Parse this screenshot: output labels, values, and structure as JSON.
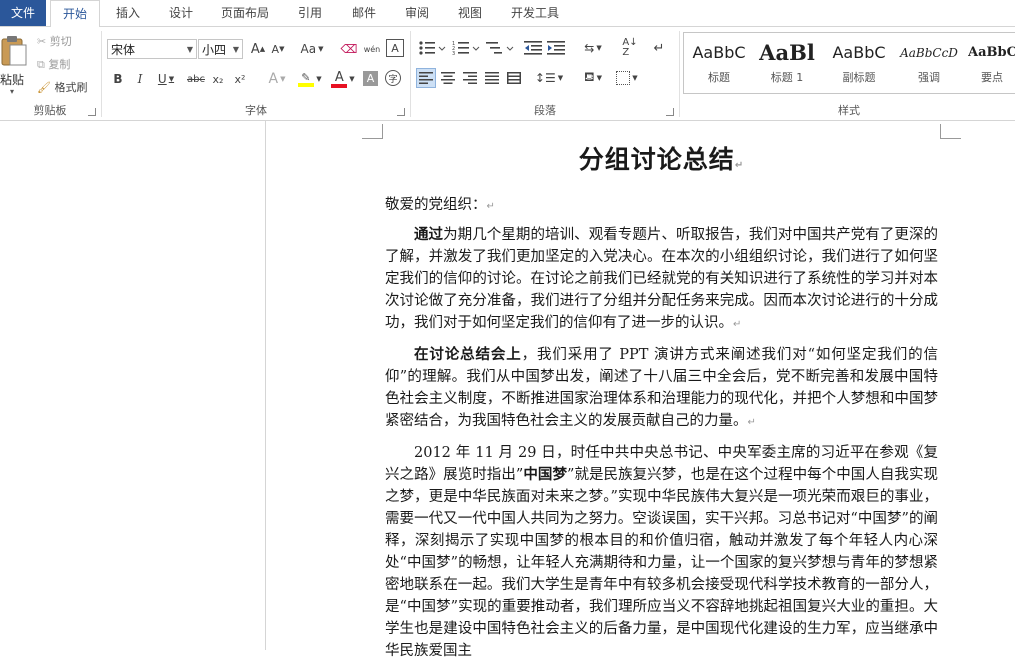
{
  "tabs": {
    "file": "文件",
    "home": "开始",
    "insert": "插入",
    "design": "设计",
    "layout": "页面布局",
    "references": "引用",
    "mailings": "邮件",
    "review": "审阅",
    "view": "视图",
    "developer": "开发工具"
  },
  "clipboard": {
    "paste": "粘贴",
    "cut": "剪切",
    "copy": "复制",
    "format_painter": "格式刷",
    "label": "剪贴板"
  },
  "font": {
    "name": "宋体",
    "size": "小四",
    "label": "字体",
    "grow": "A",
    "shrink": "A",
    "case": "Aa",
    "phonetic": "wén",
    "border_char": "A",
    "bold": "B",
    "italic": "I",
    "underline": "U",
    "strike": "abc",
    "subscript": "x₂",
    "superscript": "x²",
    "effects": "A",
    "font_color": "A",
    "shading": "A",
    "enclose": "字",
    "highlight_color": "#ffff00",
    "font_color_value": "#e81123"
  },
  "paragraph": {
    "label": "段落"
  },
  "styles": {
    "label": "样式",
    "items": [
      {
        "sample": "AaBbC",
        "name": "标题"
      },
      {
        "sample": "AaBl",
        "name": "标题 1"
      },
      {
        "sample": "AaBbC",
        "name": "副标题"
      },
      {
        "sample": "AaBbCcD",
        "name": "强调"
      },
      {
        "sample": "AaBbC",
        "name": "要点"
      }
    ]
  },
  "document": {
    "title": "分组讨论总结",
    "greeting": "敬爱的党组织：",
    "p1_bold": "通过",
    "p1_text": "为期几个星期的培训、观看专题片、听取报告，我们对中国共产党有了更深的了解，并激发了我们更加坚定的入党决心。在本次的小组组织讨论，我们进行了如何坚定我们的信仰的讨论。在讨论之前我们已经就党的有关知识进行了系统性的学习并对本次讨论做了充分准备，我们进行了分组并分配任务来完成。因而本次讨论进行的十分成功，我们对于如何坚定我们的信仰有了进一步的认识。",
    "p2_bold": "在讨论总结会上",
    "p2_text": "，我们采用了 PPT 演讲方式来阐述我们对“如何坚定我们的信仰”的理解。我们从中国梦出发，阐述了十八届三中全会后，党不断完善和发展中国特色社会主义制度，不断推进国家治理体系和治理能力的现代化，并把个人梦想和中国梦紧密结合，为我国特色社会主义的发展贡献自己的力量。",
    "p3_start": "2012 年 11 月 29 日，时任中共中央总书记、中央军委主席的习近平在参观《复兴之路》展览时指出”",
    "p3_bold": "中国梦",
    "p3_text": "”就是民族复兴梦，也是在这个过程中每个中国人自我实现之梦，更是中华民族面对未来之梦。”实现中华民族伟大复兴是一项光荣而艰巨的事业，需要一代又一代中国人共同为之努力。空谈误国，实干兴邦。习总书记对“中国梦”的阐释，深刻揭示了实现中国梦的根本目的和价值归宿，触动并激发了每个年轻人内心深处“中国梦”的畅想，让年轻人充满期待和力量，让一个国家的复兴梦想与青年的梦想紧密地联系在一起。我们大学生是青年中有较多机会接受现代科学技术教育的一部分人，是“中国梦”实现的重要推动者，我们理所应当义不容辞地挑起祖国复兴大业的重担。大学生也是建设中国特色社会主义的后备力量，是中国现代化建设的生力军，应当继承中华民族爱国主"
  }
}
